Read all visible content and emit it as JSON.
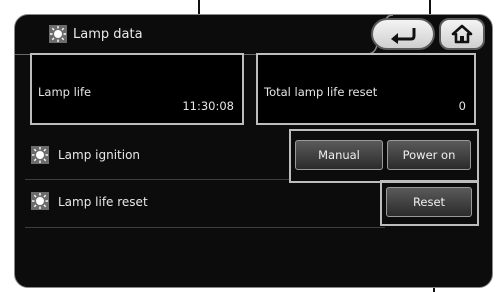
{
  "header": {
    "title": "Lamp data",
    "back_icon": "back-arrow-icon",
    "home_icon": "home-icon"
  },
  "lamp_life": {
    "label": "Lamp life",
    "value": "11:30:08"
  },
  "total_lamp_life_reset": {
    "label": "Total lamp life reset",
    "value": "0"
  },
  "lamp_ignition": {
    "label": "Lamp ignition",
    "manual_label": "Manual",
    "power_on_label": "Power on"
  },
  "lamp_life_reset": {
    "label": "Lamp life reset",
    "reset_label": "Reset"
  },
  "colors": {
    "background": "#0c0c0c",
    "frame": "#bdbdbd",
    "button": "#3a3a3a"
  }
}
